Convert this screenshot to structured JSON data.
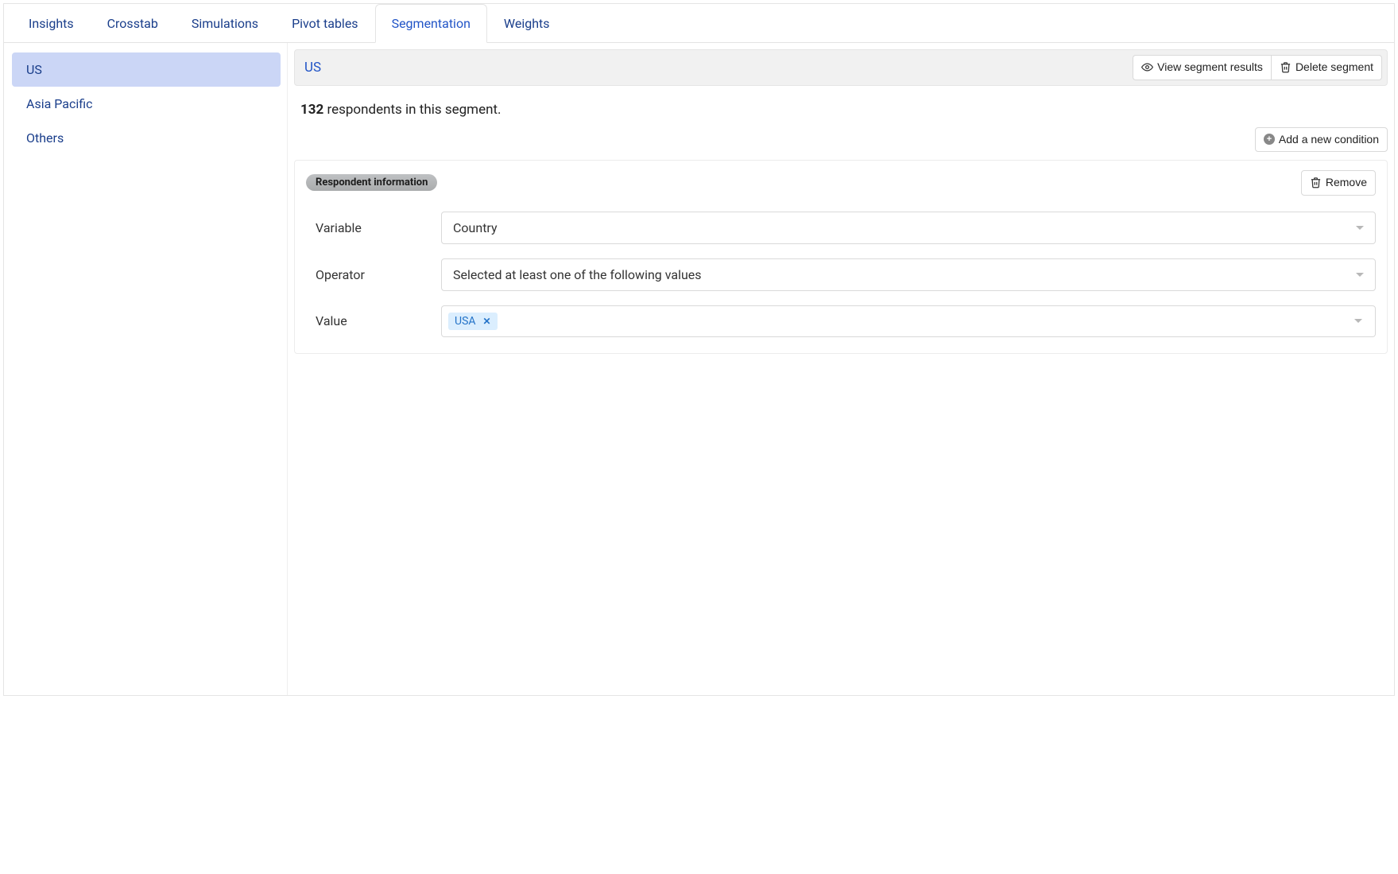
{
  "tabs": [
    {
      "label": "Insights",
      "active": false
    },
    {
      "label": "Crosstab",
      "active": false
    },
    {
      "label": "Simulations",
      "active": false
    },
    {
      "label": "Pivot tables",
      "active": false
    },
    {
      "label": "Segmentation",
      "active": true
    },
    {
      "label": "Weights",
      "active": false
    }
  ],
  "sidebar": {
    "items": [
      {
        "label": "US",
        "selected": true
      },
      {
        "label": "Asia Pacific",
        "selected": false
      },
      {
        "label": "Others",
        "selected": false
      }
    ]
  },
  "segment": {
    "title": "US",
    "view_results_label": "View segment results",
    "delete_segment_label": "Delete segment",
    "count": "132",
    "count_suffix": " respondents in this segment."
  },
  "add_condition_label": "Add a new condition",
  "condition": {
    "group_label": "Respondent information",
    "remove_label": "Remove",
    "rows": {
      "variable_label": "Variable",
      "variable_value": "Country",
      "operator_label": "Operator",
      "operator_value": "Selected at least one of the following values",
      "value_label": "Value",
      "value_tag": "USA"
    }
  }
}
